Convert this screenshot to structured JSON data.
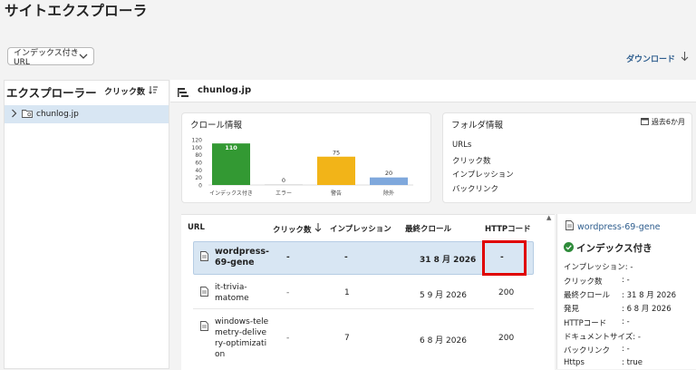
{
  "page": {
    "title": "サイトエクスプローラ"
  },
  "toolbar": {
    "filter_label": "インデックス付きURL",
    "download_label": "ダウンロード"
  },
  "explorer": {
    "title": "エクスプローラー",
    "sort_label": "クリック数",
    "tree": [
      {
        "label": "chunlog.jp"
      }
    ]
  },
  "breadcrumb": {
    "site": "chunlog.jp"
  },
  "crawl_info": {
    "title": "クロール情報"
  },
  "chart_data": {
    "type": "bar",
    "categories": [
      "インデックス付き",
      "エラー",
      "警告",
      "除外"
    ],
    "values": [
      110,
      0,
      75,
      20
    ],
    "colors": [
      "#339933",
      "#cccccc",
      "#f2b418",
      "#7fa8dc"
    ],
    "yticks": [
      "120",
      "100",
      "80",
      "60",
      "40",
      "20",
      "0"
    ],
    "ylim": [
      0,
      120
    ],
    "grid": false
  },
  "folder_info": {
    "title": "フォルダ情報",
    "period": "過去6か月",
    "items": [
      "URLs",
      "クリック数",
      "インプレッション",
      "バックリンク"
    ]
  },
  "table": {
    "headers": {
      "url": "URL",
      "clicks": "クリック数",
      "impressions": "インプレッション",
      "last_crawl": "最終クロール",
      "http": "HTTPコード"
    },
    "rows": [
      {
        "url": "wordpress-69-gene",
        "clicks": "-",
        "impressions": "-",
        "last_crawl": "31 8 月 2026",
        "http": "-"
      },
      {
        "url": "it-trivia-matome",
        "clicks": "-",
        "impressions": "1",
        "last_crawl": "5 9 月 2026",
        "http": "200"
      },
      {
        "url": "windows-telemetry-delivery-optimization",
        "clicks": "-",
        "impressions": "7",
        "last_crawl": "6 8 月 2026",
        "http": "200"
      }
    ]
  },
  "detail": {
    "title": "wordpress-69-gene",
    "status": "インデックス付き",
    "fields": [
      {
        "k": "インプレッション",
        "v": ": -"
      },
      {
        "k": "クリック数",
        "v": ": -"
      },
      {
        "k": "最終クロール",
        "v": ": 31 8 月 2026"
      },
      {
        "k": "発見",
        "v": ": 6 8 月 2026"
      },
      {
        "k": "HTTPコード",
        "v": ": -"
      },
      {
        "k": "ドキュメントサイズ",
        "v": ": -"
      },
      {
        "k": "バックリンク",
        "v": ": -"
      },
      {
        "k": "Https",
        "v": ": true"
      }
    ]
  }
}
